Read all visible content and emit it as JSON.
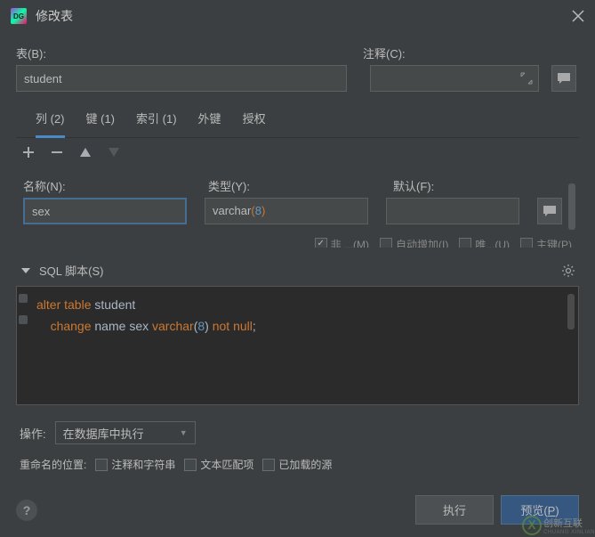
{
  "window": {
    "title": "修改表",
    "app_icon_text": "DG"
  },
  "labels": {
    "table": "表(B):",
    "comment": "注释(C):",
    "name": "名称(N):",
    "type": "类型(Y):",
    "default": "默认(F):",
    "sql_script": "SQL 脚本(S)",
    "operation": "操作:",
    "rename_pos": "重命名的位置:",
    "comment_charset": "注释和字符串",
    "text_match": "文本匹配项",
    "loaded_src": "已加载的源"
  },
  "inputs": {
    "table_name": "student",
    "col_name": "sex",
    "col_type_base": "varchar",
    "col_type_size": "8",
    "col_default": ""
  },
  "tabs": [
    {
      "label": "列 (2)",
      "active": true
    },
    {
      "label": "键 (1)",
      "active": false
    },
    {
      "label": "索引 (1)",
      "active": false
    },
    {
      "label": "外键",
      "active": false
    },
    {
      "label": "授权",
      "active": false
    }
  ],
  "checks_partial": [
    {
      "label": "非 ...(M)",
      "checked": true
    },
    {
      "label": "自动增加(I)",
      "checked": false
    },
    {
      "label": "唯...(U)",
      "checked": false
    },
    {
      "label": "主键(P)",
      "checked": false
    }
  ],
  "sql": {
    "line1": {
      "k1": "alter",
      "k2": "table",
      "ident": "student"
    },
    "line2": {
      "k1": "change",
      "i1": "name",
      "i2": "sex",
      "t": "varchar",
      "n": "8",
      "k2": "not",
      "k3": "null"
    }
  },
  "dropdown": {
    "selected": "在数据库中执行"
  },
  "buttons": {
    "execute": "执行",
    "preview": "预览(P)"
  },
  "watermark": {
    "text": "创新互联",
    "sub": "CHUANG XINLIAN"
  }
}
